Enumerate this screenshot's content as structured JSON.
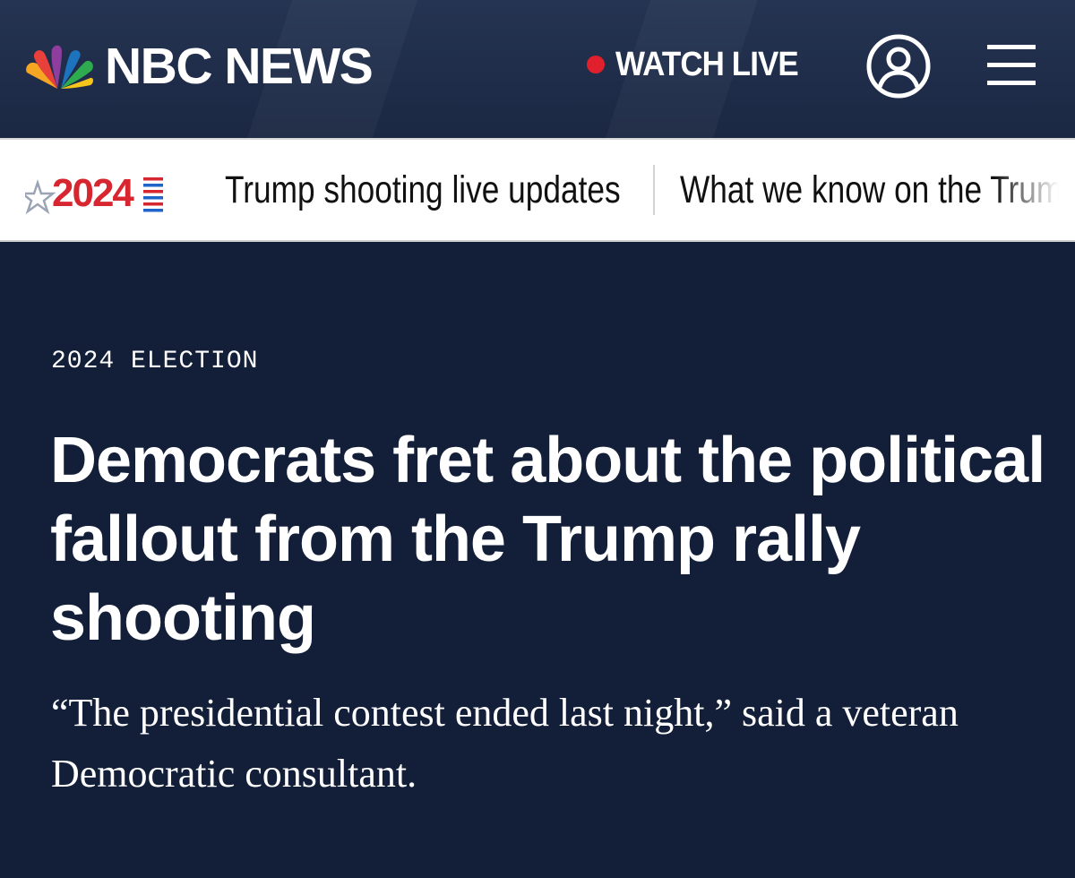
{
  "header": {
    "brand": "NBC NEWS",
    "watch_live": "WATCH LIVE",
    "account_icon": "user-circle-icon",
    "menu_icon": "hamburger-menu-icon",
    "colors": {
      "background": "#1f2d4a",
      "live_dot": "#e0202c"
    }
  },
  "ticker": {
    "badge_year": "2024",
    "items": [
      {
        "label": "Trump shooting live updates"
      },
      {
        "label": "What we know on the Trum"
      }
    ]
  },
  "article": {
    "eyebrow": "2024 ELECTION",
    "headline": "Democrats fret about the political fallout from the Trump rally shooting",
    "dek": "“The presidential contest ended last night,” said a veteran Democratic consultant.",
    "colors": {
      "background": "#131f38",
      "text": "#ffffff"
    }
  }
}
